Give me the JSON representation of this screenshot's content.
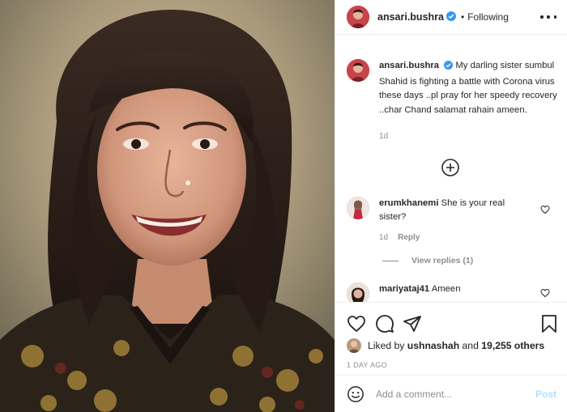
{
  "colors": {
    "accent": "#0095f6",
    "post_disabled": "#b2dffc",
    "muted": "#8e8e8e",
    "text": "#262626",
    "verified": "#3897f0",
    "border": "#efefef"
  },
  "header": {
    "username": "ansari.bushra",
    "separator": "•",
    "follow_status": "Following",
    "more_icon": "more-horizontal-icon"
  },
  "caption": {
    "username": "ansari.bushra",
    "text": "My darling sister sumbul Shahid is fighting a battle with Corona virus these days ..pl pray for her speedy recovery ..char Chand salamat rahain ameen.",
    "time": "1d"
  },
  "load_more_icon": "plus-circle-icon",
  "comments": [
    {
      "username": "erumkhanemi",
      "text": "She is your real sister?",
      "time": "1d",
      "reply_label": "Reply",
      "view_replies": "View replies (1)"
    },
    {
      "username": "mariyataj41",
      "text": "Ameen"
    }
  ],
  "actions": {
    "like_icon": "heart-icon",
    "comment_icon": "comment-icon",
    "share_icon": "paper-plane-icon",
    "save_icon": "bookmark-icon"
  },
  "likes": {
    "prefix": "Liked by",
    "user": "ushnashah",
    "middle": "and",
    "count": "19,255 others"
  },
  "date": "1 DAY AGO",
  "composer": {
    "placeholder": "Add a comment...",
    "post_label": "Post",
    "emoji_icon": "smiley-icon"
  }
}
